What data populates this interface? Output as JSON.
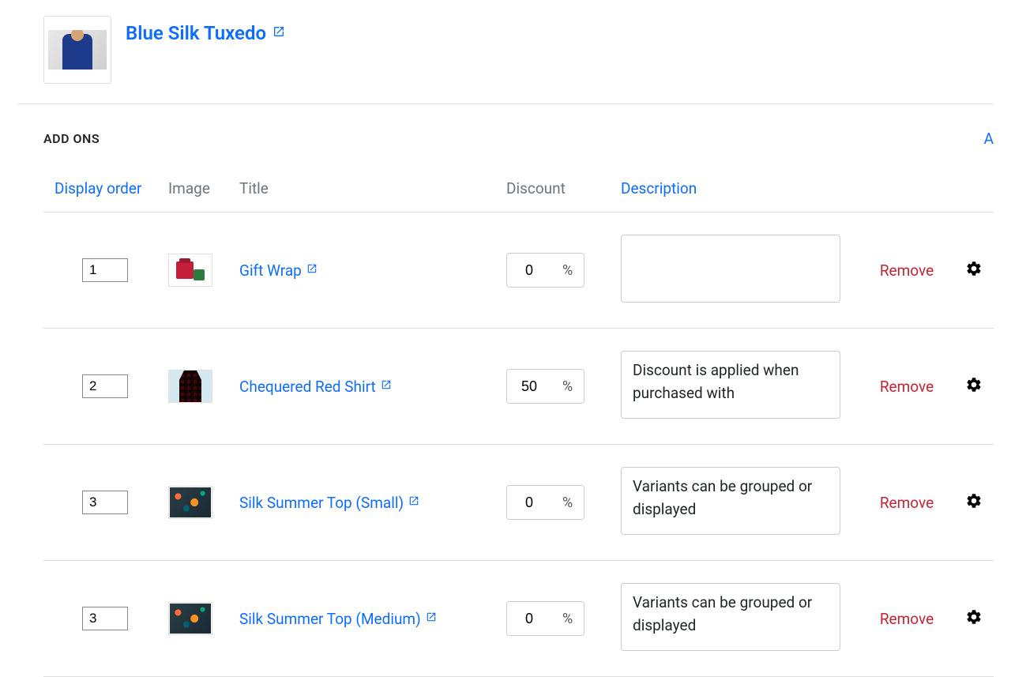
{
  "product": {
    "title": "Blue Silk Tuxedo"
  },
  "section": {
    "title": "ADD ONS",
    "add_link_partial": "A"
  },
  "columns": {
    "display_order": "Display order",
    "image": "Image",
    "title": "Title",
    "discount": "Discount",
    "description": "Description"
  },
  "percent_symbol": "%",
  "remove_label": "Remove",
  "rows": [
    {
      "order": "1",
      "title": "Gift Wrap",
      "discount": "0",
      "description": "",
      "thumb_kind": "gift"
    },
    {
      "order": "2",
      "title": "Chequered Red Shirt",
      "discount": "50",
      "description": "Discount is applied when purchased with ",
      "thumb_kind": "plaid"
    },
    {
      "order": "3",
      "title": "Silk Summer Top (Small)",
      "discount": "0",
      "description": "Variants can be grouped or displayed ",
      "thumb_kind": "summer"
    },
    {
      "order": "3",
      "title": "Silk Summer Top (Medium)",
      "discount": "0",
      "description": "Variants can be grouped or displayed ",
      "thumb_kind": "summer"
    }
  ]
}
